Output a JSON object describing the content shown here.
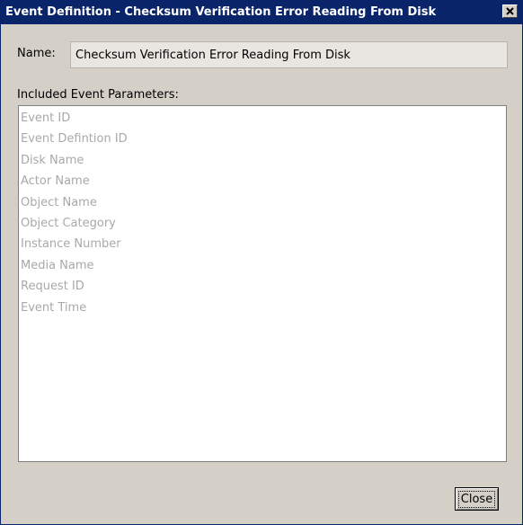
{
  "window": {
    "title": "Event Definition - Checksum Verification Error Reading From Disk"
  },
  "form": {
    "name_label": "Name:",
    "name_value": "Checksum Verification Error Reading From Disk",
    "params_label": "Included Event Parameters:",
    "parameters": [
      "Event ID",
      "Event Defintion ID",
      "Disk Name",
      "Actor Name",
      "Object Name",
      "Object Category",
      "Instance Number",
      "Media Name",
      "Request ID",
      "Event Time"
    ]
  },
  "buttons": {
    "close_label": "Close"
  },
  "icons": {
    "titlebar_close": "close-icon"
  },
  "colors": {
    "titlebar": "#0a246a",
    "dialog_background": "#d4d0c8",
    "disabled_text": "#a9a9a9"
  }
}
